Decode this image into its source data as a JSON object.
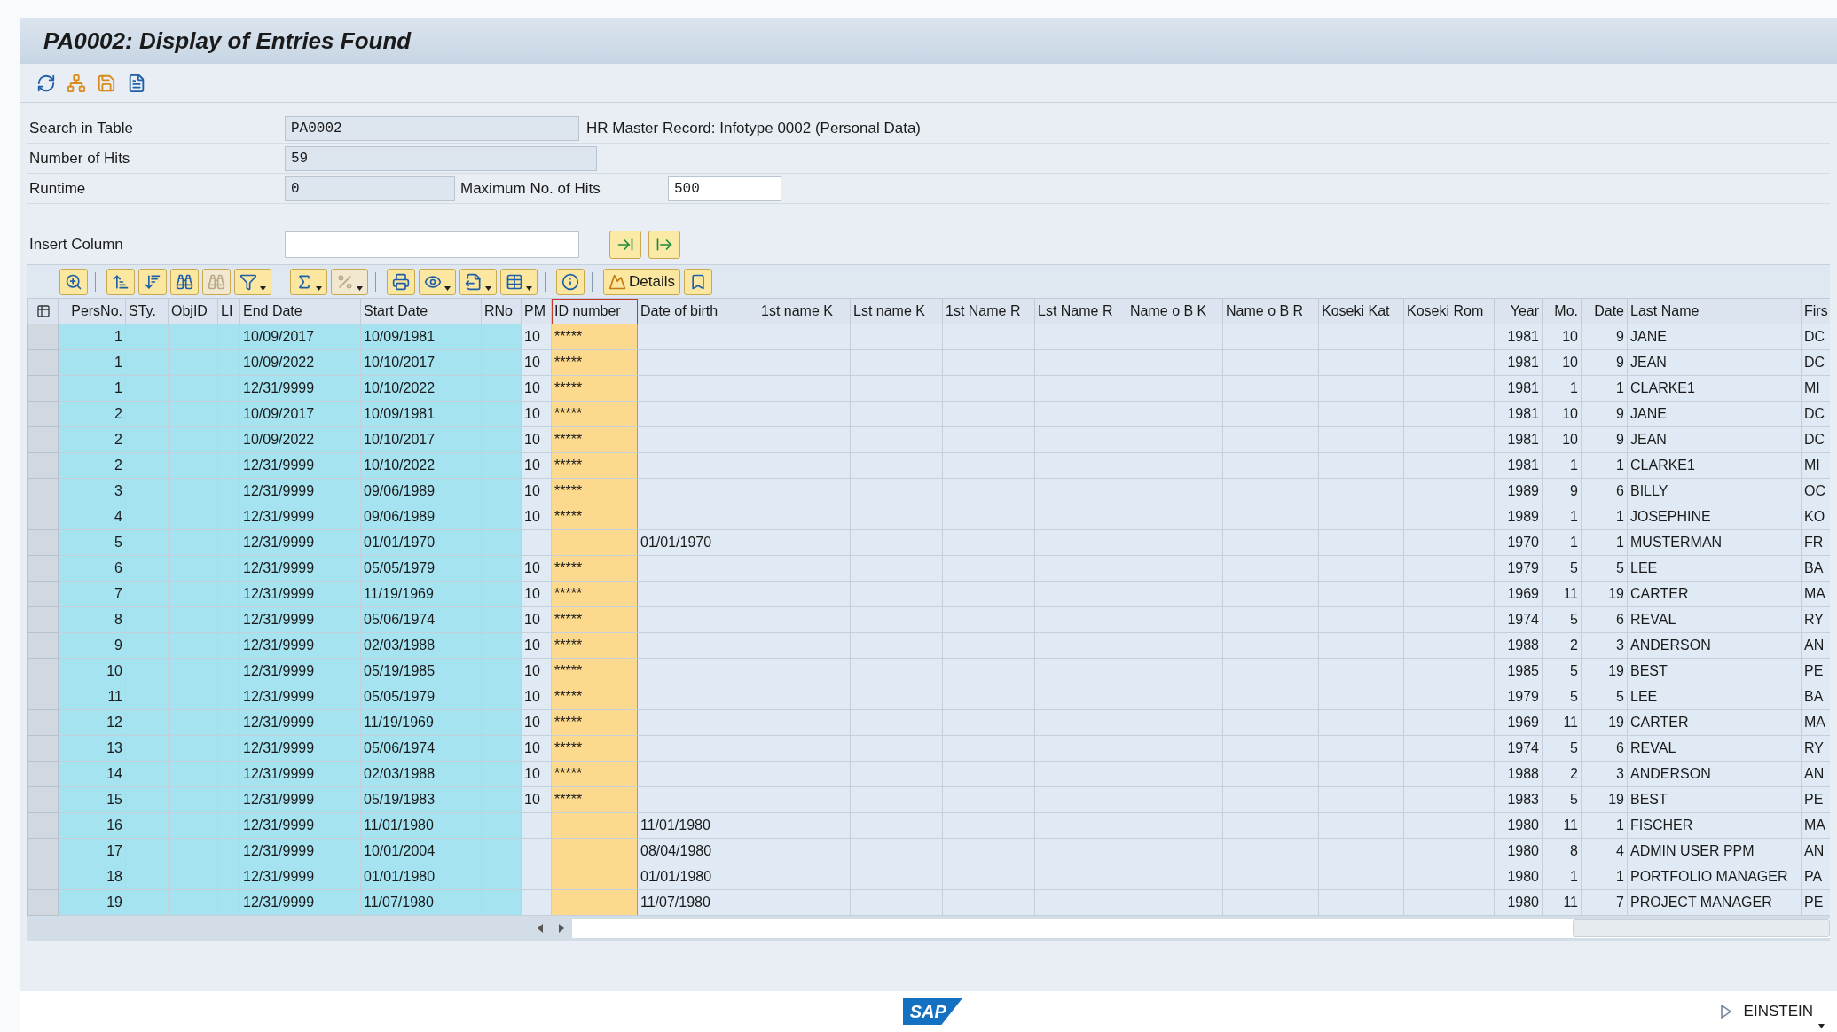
{
  "window": {
    "title": "PA0002: Display of Entries Found"
  },
  "form": {
    "search_in_table": {
      "label": "Search in Table",
      "value": "PA0002",
      "description": "HR Master Record: Infotype 0002 (Personal Data)"
    },
    "number_of_hits": {
      "label": "Number of Hits",
      "value": "59"
    },
    "runtime": {
      "label": "Runtime",
      "value": "0"
    },
    "maximum_hits": {
      "label": "Maximum No. of Hits",
      "value": "500"
    },
    "insert_column": {
      "label": "Insert Column"
    }
  },
  "alv_toolbar": {
    "groups": [
      [
        {
          "kind": "icon",
          "disabled": false,
          "dropdown": false
        }
      ],
      [
        {
          "kind": "icon",
          "disabled": false,
          "dropdown": false
        },
        {
          "kind": "icon",
          "disabled": false,
          "dropdown": false
        },
        {
          "kind": "icon",
          "disabled": false,
          "dropdown": false
        },
        {
          "kind": "icon",
          "disabled": true,
          "dropdown": false
        },
        {
          "kind": "icon",
          "disabled": false,
          "dropdown": true
        }
      ],
      [
        {
          "kind": "icon",
          "disabled": false,
          "dropdown": true
        },
        {
          "kind": "icon",
          "disabled": true,
          "dropdown": true
        }
      ],
      [
        {
          "kind": "icon",
          "disabled": false,
          "dropdown": false
        },
        {
          "kind": "icon",
          "disabled": false,
          "dropdown": true
        },
        {
          "kind": "icon",
          "disabled": false,
          "dropdown": true
        },
        {
          "kind": "icon",
          "disabled": false,
          "dropdown": true
        }
      ],
      [
        {
          "kind": "icon",
          "disabled": false,
          "dropdown": false
        }
      ],
      [
        {
          "kind": "text",
          "label": "Details",
          "disabled": false,
          "dropdown": false
        },
        {
          "kind": "icon",
          "disabled": false,
          "dropdown": false
        }
      ]
    ]
  },
  "table": {
    "columns": [
      {
        "label": "PersNo.",
        "kind": "keynum",
        "selected": false
      },
      {
        "label": "STy.",
        "kind": "key",
        "selected": false
      },
      {
        "label": "ObjID",
        "kind": "key",
        "selected": false
      },
      {
        "label": "LI",
        "kind": "key",
        "selected": false
      },
      {
        "label": "End Date",
        "kind": "key",
        "selected": false
      },
      {
        "label": "Start Date",
        "kind": "key",
        "selected": false
      },
      {
        "label": "RNo",
        "kind": "key",
        "selected": false
      },
      {
        "label": "PM",
        "kind": "text",
        "selected": false
      },
      {
        "label": "ID number",
        "kind": "text",
        "selected": true
      },
      {
        "label": "Date of birth",
        "kind": "text",
        "selected": false
      },
      {
        "label": "1st name K",
        "kind": "text",
        "selected": false
      },
      {
        "label": "Lst name K",
        "kind": "text",
        "selected": false
      },
      {
        "label": "1st Name R",
        "kind": "text",
        "selected": false
      },
      {
        "label": "Lst Name R",
        "kind": "text",
        "selected": false
      },
      {
        "label": "Name o B K",
        "kind": "text",
        "selected": false
      },
      {
        "label": "Name o B R",
        "kind": "text",
        "selected": false
      },
      {
        "label": "Koseki Kat",
        "kind": "text",
        "selected": false
      },
      {
        "label": "Koseki Rom",
        "kind": "text",
        "selected": false
      },
      {
        "label": "Year",
        "kind": "number",
        "selected": false
      },
      {
        "label": "Mo.",
        "kind": "number",
        "selected": false
      },
      {
        "label": "Date",
        "kind": "number",
        "selected": false
      },
      {
        "label": "Last Name",
        "kind": "text",
        "selected": false
      },
      {
        "label": "Firs",
        "kind": "text",
        "selected": false
      }
    ],
    "rows": [
      [
        "1",
        null,
        null,
        null,
        "10/09/2017",
        "10/09/1981",
        null,
        "10",
        "*****",
        null,
        null,
        null,
        null,
        null,
        null,
        null,
        null,
        null,
        "1981",
        "10",
        "9",
        "JANE",
        "DC"
      ],
      [
        "1",
        null,
        null,
        null,
        "10/09/2022",
        "10/10/2017",
        null,
        "10",
        "*****",
        null,
        null,
        null,
        null,
        null,
        null,
        null,
        null,
        null,
        "1981",
        "10",
        "9",
        "JEAN",
        "DC"
      ],
      [
        "1",
        null,
        null,
        null,
        "12/31/9999",
        "10/10/2022",
        null,
        "10",
        "*****",
        null,
        null,
        null,
        null,
        null,
        null,
        null,
        null,
        null,
        "1981",
        "1",
        "1",
        "CLARKE1",
        "MI"
      ],
      [
        "2",
        null,
        null,
        null,
        "10/09/2017",
        "10/09/1981",
        null,
        "10",
        "*****",
        null,
        null,
        null,
        null,
        null,
        null,
        null,
        null,
        null,
        "1981",
        "10",
        "9",
        "JANE",
        "DC"
      ],
      [
        "2",
        null,
        null,
        null,
        "10/09/2022",
        "10/10/2017",
        null,
        "10",
        "*****",
        null,
        null,
        null,
        null,
        null,
        null,
        null,
        null,
        null,
        "1981",
        "10",
        "9",
        "JEAN",
        "DC"
      ],
      [
        "2",
        null,
        null,
        null,
        "12/31/9999",
        "10/10/2022",
        null,
        "10",
        "*****",
        null,
        null,
        null,
        null,
        null,
        null,
        null,
        null,
        null,
        "1981",
        "1",
        "1",
        "CLARKE1",
        "MI"
      ],
      [
        "3",
        null,
        null,
        null,
        "12/31/9999",
        "09/06/1989",
        null,
        "10",
        "*****",
        null,
        null,
        null,
        null,
        null,
        null,
        null,
        null,
        null,
        "1989",
        "9",
        "6",
        "BILLY",
        "OC"
      ],
      [
        "4",
        null,
        null,
        null,
        "12/31/9999",
        "09/06/1989",
        null,
        "10",
        "*****",
        null,
        null,
        null,
        null,
        null,
        null,
        null,
        null,
        null,
        "1989",
        "1",
        "1",
        "JOSEPHINE",
        "KO"
      ],
      [
        "5",
        null,
        null,
        null,
        "12/31/9999",
        "01/01/1970",
        null,
        null,
        null,
        "01/01/1970",
        null,
        null,
        null,
        null,
        null,
        null,
        null,
        null,
        "1970",
        "1",
        "1",
        "MUSTERMAN",
        "FR"
      ],
      [
        "6",
        null,
        null,
        null,
        "12/31/9999",
        "05/05/1979",
        null,
        "10",
        "*****",
        null,
        null,
        null,
        null,
        null,
        null,
        null,
        null,
        null,
        "1979",
        "5",
        "5",
        "LEE",
        "BA"
      ],
      [
        "7",
        null,
        null,
        null,
        "12/31/9999",
        "11/19/1969",
        null,
        "10",
        "*****",
        null,
        null,
        null,
        null,
        null,
        null,
        null,
        null,
        null,
        "1969",
        "11",
        "19",
        "CARTER",
        "MA"
      ],
      [
        "8",
        null,
        null,
        null,
        "12/31/9999",
        "05/06/1974",
        null,
        "10",
        "*****",
        null,
        null,
        null,
        null,
        null,
        null,
        null,
        null,
        null,
        "1974",
        "5",
        "6",
        "REVAL",
        "RY"
      ],
      [
        "9",
        null,
        null,
        null,
        "12/31/9999",
        "02/03/1988",
        null,
        "10",
        "*****",
        null,
        null,
        null,
        null,
        null,
        null,
        null,
        null,
        null,
        "1988",
        "2",
        "3",
        "ANDERSON",
        "AN"
      ],
      [
        "10",
        null,
        null,
        null,
        "12/31/9999",
        "05/19/1985",
        null,
        "10",
        "*****",
        null,
        null,
        null,
        null,
        null,
        null,
        null,
        null,
        null,
        "1985",
        "5",
        "19",
        "BEST",
        "PE"
      ],
      [
        "11",
        null,
        null,
        null,
        "12/31/9999",
        "05/05/1979",
        null,
        "10",
        "*****",
        null,
        null,
        null,
        null,
        null,
        null,
        null,
        null,
        null,
        "1979",
        "5",
        "5",
        "LEE",
        "BA"
      ],
      [
        "12",
        null,
        null,
        null,
        "12/31/9999",
        "11/19/1969",
        null,
        "10",
        "*****",
        null,
        null,
        null,
        null,
        null,
        null,
        null,
        null,
        null,
        "1969",
        "11",
        "19",
        "CARTER",
        "MA"
      ],
      [
        "13",
        null,
        null,
        null,
        "12/31/9999",
        "05/06/1974",
        null,
        "10",
        "*****",
        null,
        null,
        null,
        null,
        null,
        null,
        null,
        null,
        null,
        "1974",
        "5",
        "6",
        "REVAL",
        "RY"
      ],
      [
        "14",
        null,
        null,
        null,
        "12/31/9999",
        "02/03/1988",
        null,
        "10",
        "*****",
        null,
        null,
        null,
        null,
        null,
        null,
        null,
        null,
        null,
        "1988",
        "2",
        "3",
        "ANDERSON",
        "AN"
      ],
      [
        "15",
        null,
        null,
        null,
        "12/31/9999",
        "05/19/1983",
        null,
        "10",
        "*****",
        null,
        null,
        null,
        null,
        null,
        null,
        null,
        null,
        null,
        "1983",
        "5",
        "19",
        "BEST",
        "PE"
      ],
      [
        "16",
        null,
        null,
        null,
        "12/31/9999",
        "11/01/1980",
        null,
        null,
        null,
        "11/01/1980",
        null,
        null,
        null,
        null,
        null,
        null,
        null,
        null,
        "1980",
        "11",
        "1",
        "FISCHER",
        "MA"
      ],
      [
        "17",
        null,
        null,
        null,
        "12/31/9999",
        "10/01/2004",
        null,
        null,
        null,
        "08/04/1980",
        null,
        null,
        null,
        null,
        null,
        null,
        null,
        null,
        "1980",
        "8",
        "4",
        "ADMIN USER PPM",
        "AN"
      ],
      [
        "18",
        null,
        null,
        null,
        "12/31/9999",
        "01/01/1980",
        null,
        null,
        null,
        "01/01/1980",
        null,
        null,
        null,
        null,
        null,
        null,
        null,
        null,
        "1980",
        "1",
        "1",
        "PORTFOLIO MANAGER",
        "PA"
      ],
      [
        "19",
        null,
        null,
        null,
        "12/31/9999",
        "11/07/1980",
        null,
        null,
        null,
        "11/07/1980",
        null,
        null,
        null,
        null,
        null,
        null,
        null,
        null,
        "1980",
        "11",
        "7",
        "PROJECT MANAGER",
        "PE"
      ]
    ]
  },
  "status_bar": {
    "logo_text": "SAP",
    "user": "EINSTEIN"
  }
}
